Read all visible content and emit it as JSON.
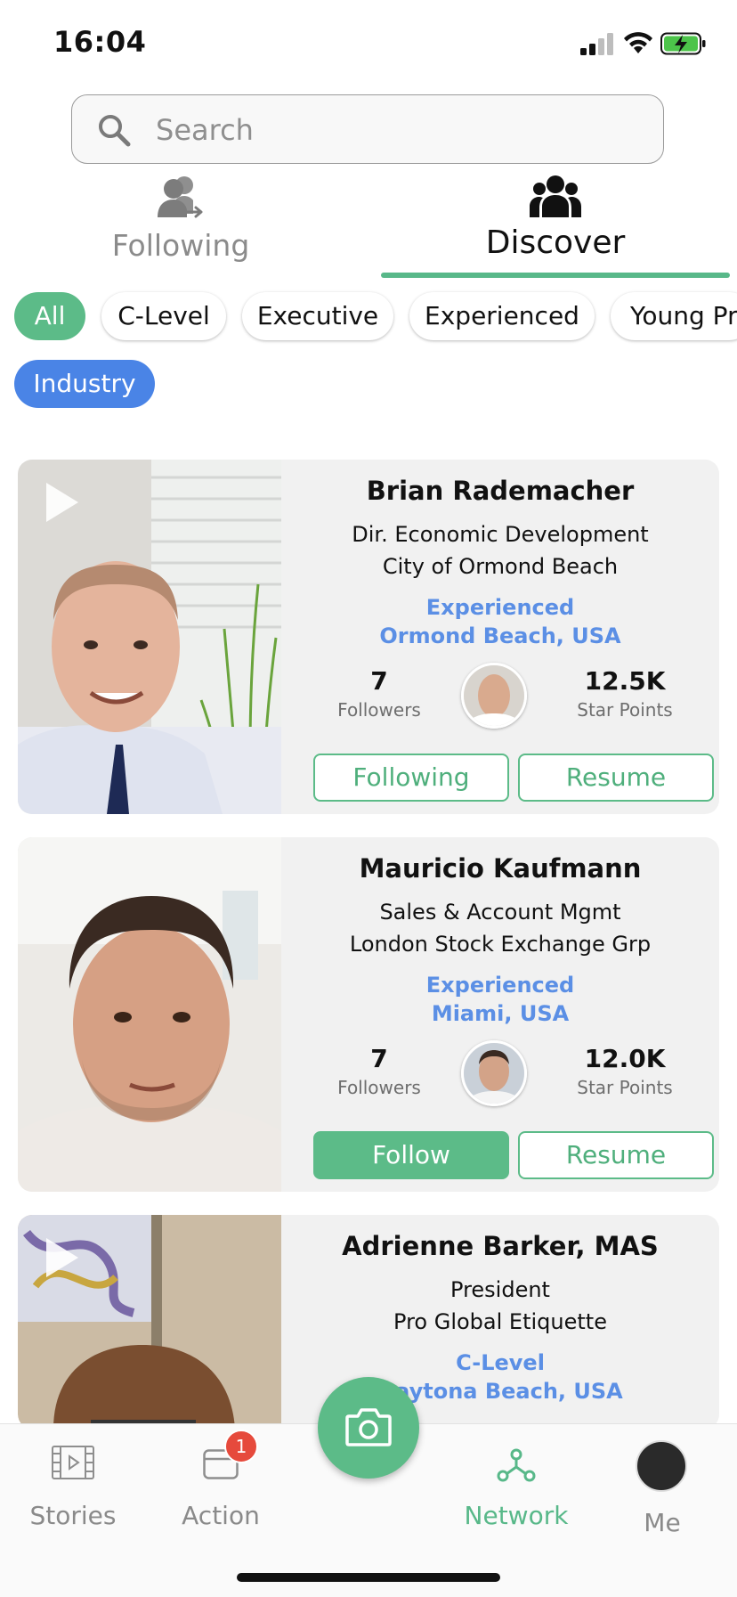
{
  "status_bar": {
    "time": "16:04"
  },
  "search": {
    "placeholder": "Search"
  },
  "tabs": [
    {
      "label": "Following",
      "icon": "person-follow-icon",
      "active": false
    },
    {
      "label": "Discover",
      "icon": "group-icon",
      "active": true
    }
  ],
  "filters": [
    {
      "label": "All",
      "selected": true
    },
    {
      "label": "C-Level",
      "selected": false
    },
    {
      "label": "Executive",
      "selected": false
    },
    {
      "label": "Experienced",
      "selected": false
    },
    {
      "label": "Young Pr",
      "selected": false
    },
    {
      "label": "Industry",
      "selected": true
    }
  ],
  "cards": [
    {
      "name": "Brian Rademacher",
      "title": "Dir. Economic Development",
      "company": "City of Ormond Beach",
      "level": "Experienced",
      "location": "Ormond Beach, USA",
      "followers_count": "7",
      "followers_label": "Followers",
      "points": "12.5K",
      "points_label": "Star Points",
      "primary_action": "Following",
      "secondary_action": "Resume"
    },
    {
      "name": "Mauricio Kaufmann",
      "title": "Sales & Account Mgmt",
      "company": "London Stock Exchange Grp",
      "level": "Experienced",
      "location": "Miami, USA",
      "followers_count": "7",
      "followers_label": "Followers",
      "points": "12.0K",
      "points_label": "Star Points",
      "primary_action": "Follow",
      "secondary_action": "Resume"
    },
    {
      "name": "Adrienne Barker, MAS",
      "title": "President",
      "company": "Pro Global Etiquette",
      "level": "C-Level",
      "location": "Daytona Beach, USA"
    }
  ],
  "bottom_nav": {
    "stories": "Stories",
    "action": "Action",
    "action_badge": "1",
    "network": "Network",
    "me": "Me"
  },
  "colors": {
    "accent_green": "#5cbb88",
    "accent_blue": "#4a84e6",
    "link_blue": "#5b8fe5",
    "badge_red": "#e64a3c"
  }
}
